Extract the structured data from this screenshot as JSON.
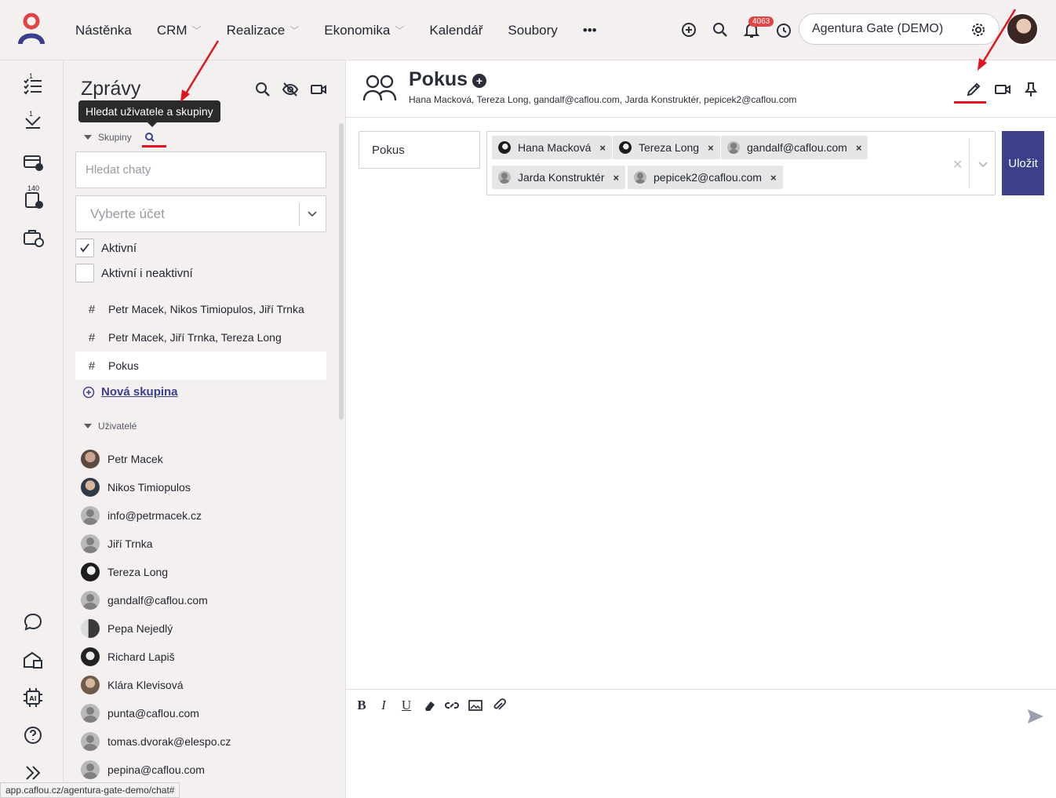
{
  "nav": {
    "items": [
      {
        "label": "Nástěnka",
        "has_menu": false
      },
      {
        "label": "CRM",
        "has_menu": true
      },
      {
        "label": "Realizace",
        "has_menu": true
      },
      {
        "label": "Ekonomika",
        "has_menu": true
      },
      {
        "label": "Kalendář",
        "has_menu": false
      },
      {
        "label": "Soubory",
        "has_menu": false
      },
      {
        "label": "•••",
        "has_menu": false
      }
    ],
    "notification_count": "4063",
    "account_name": "Agentura Gate (DEMO)"
  },
  "rail": {
    "counts": [
      "1",
      "1",
      "140"
    ]
  },
  "panel": {
    "title": "Zprávy",
    "tooltip": "Hledat uživatele a skupiny",
    "groups_heading": "Skupiny",
    "search_placeholder": "Hledat chaty",
    "account_placeholder": "Vyberte účet",
    "filters": [
      {
        "label": "Aktivní",
        "checked": true
      },
      {
        "label": "Aktivní i neaktivní",
        "checked": false
      }
    ],
    "groups": [
      {
        "name": "Petr Macek, Nikos Timiopulos, Jiří Trnka",
        "active": false
      },
      {
        "name": "Petr Macek, Jiří Trnka, Tereza Long",
        "active": false
      },
      {
        "name": "Pokus",
        "active": true
      }
    ],
    "new_group": "Nová skupina",
    "users_heading": "Uživatelé",
    "users": [
      {
        "name": "Petr Macek",
        "avatar": "photo1"
      },
      {
        "name": "Nikos Timiopulos",
        "avatar": "photo2"
      },
      {
        "name": "info@petrmacek.cz",
        "avatar": "default"
      },
      {
        "name": "Jiří Trnka",
        "avatar": "default"
      },
      {
        "name": "Tereza Long",
        "avatar": "photo3"
      },
      {
        "name": "gandalf@caflou.com",
        "avatar": "default"
      },
      {
        "name": "Pepa Nejedlý",
        "avatar": "photo4"
      },
      {
        "name": "Richard Lapiš",
        "avatar": "photo5"
      },
      {
        "name": "Klára Klevisová",
        "avatar": "photo6"
      },
      {
        "name": "punta@caflou.com",
        "avatar": "default"
      },
      {
        "name": "tomas.dvorak@elespo.cz",
        "avatar": "default"
      },
      {
        "name": "pepina@caflou.com",
        "avatar": "default"
      }
    ]
  },
  "main": {
    "title": "Pokus",
    "members_line": "Hana Macková, Tereza Long, gandalf@caflou.com, Jarda Konstruktér, pepicek2@caflou.com",
    "name_value": "Pokus",
    "members": [
      {
        "name": "Hana Macková",
        "avatar": "photo3"
      },
      {
        "name": "Tereza Long",
        "avatar": "photo3"
      },
      {
        "name": "gandalf@caflou.com",
        "avatar": "default"
      },
      {
        "name": "Jarda Konstruktér",
        "avatar": "default"
      },
      {
        "name": "pepicek2@caflou.com",
        "avatar": "default"
      }
    ],
    "save_label": "Uložit",
    "toolbar": [
      "B",
      "I",
      "U"
    ]
  },
  "status_url": "app.caflou.cz/agentura-gate-demo/chat#",
  "colors": {
    "accent": "#3b3f8c",
    "highlight": "#e0141e",
    "background": "#f5f0f0"
  }
}
